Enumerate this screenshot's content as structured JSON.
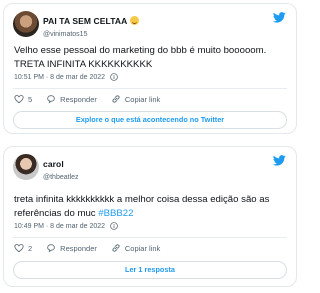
{
  "tweets": [
    {
      "display_name": "PAI TA SEM CELTAA",
      "has_emoji": true,
      "handle": "@vinimatos15",
      "text": "Velho esse pessoal do marketing do bbb é muito booooom. TRETA INFINITA KKKKKKKKKK",
      "time": "10:51 PM · 8 de mar de 2022",
      "likes": "5",
      "reply_label": "Responder",
      "copy_label": "Copiar link",
      "cta": "Explore o que está acontecendo no Twitter"
    },
    {
      "display_name": "carol",
      "has_emoji": false,
      "handle": "@thbeatlez",
      "text": "treta infinita kkkkkkkkkk a melhor coisa dessa edição são as referências do muc ",
      "hashtag": "#BBB22",
      "time": "10:49 PM · 8 de mar de 2022",
      "likes": "2",
      "reply_label": "Responder",
      "copy_label": "Copiar link",
      "cta": "Ler 1 resposta"
    }
  ],
  "colors": {
    "accent": "#1d9bf0",
    "muted": "#536471",
    "border": "#e3e8ec"
  },
  "icons": [
    "twitter-bird-icon",
    "heart-icon",
    "reply-icon",
    "link-icon",
    "info-icon"
  ]
}
